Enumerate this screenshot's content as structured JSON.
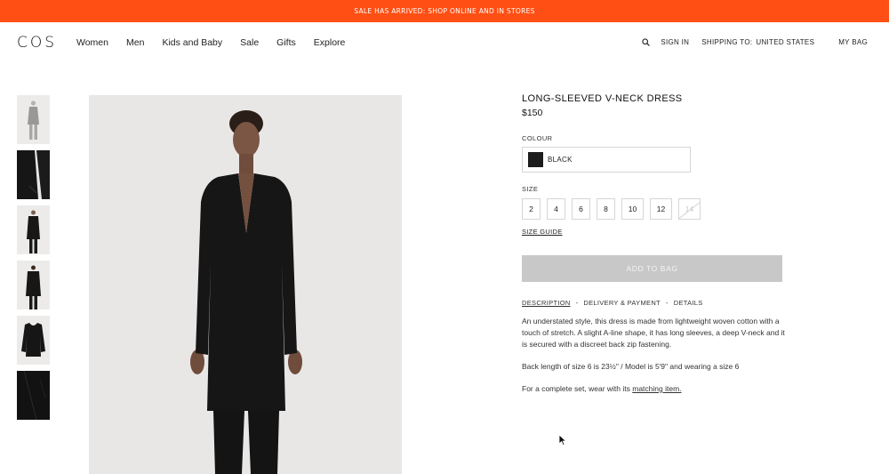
{
  "promo": {
    "text": "SALE HAS ARRIVED: SHOP ONLINE AND IN STORES"
  },
  "header": {
    "logo": "COS",
    "nav": [
      "Women",
      "Men",
      "Kids and Baby",
      "Sale",
      "Gifts",
      "Explore"
    ],
    "sign_in": "SIGN IN",
    "shipping_label": "SHIPPING TO:",
    "shipping_value": "UNITED STATES",
    "bag": "MY BAG",
    "search_icon": "search-icon"
  },
  "product": {
    "title": "LONG-SLEEVED V-NECK DRESS",
    "price": "$150",
    "colour_label": "COLOUR",
    "colour_value": "BLACK",
    "colour_hex": "#1c1c1c",
    "size_label": "SIZE",
    "sizes": [
      "2",
      "4",
      "6",
      "8",
      "10",
      "12",
      "14"
    ],
    "unavailable_sizes": [
      "14"
    ],
    "size_guide": "SIZE GUIDE",
    "add_to_bag": "ADD TO BAG",
    "tabs": [
      "DESCRIPTION",
      "DELIVERY & PAYMENT",
      "DETAILS"
    ],
    "tab_separator": "-",
    "description": "An understated style, this dress is made from lightweight woven cotton with a touch of stretch. A slight A-line shape, it has long sleeves, a deep V-neck and it is secured with a discreet back zip fastening.",
    "back_length": "Back length of size 6 is 23½\" / Model is 5'9\" and wearing a size 6",
    "complete_set_prefix": "For a complete set, wear with its ",
    "complete_set_link": "matching item."
  },
  "colors": {
    "promo_bg": "#ff4f14",
    "button_disabled": "#c8c8c8",
    "image_bg": "#e9e7e6"
  }
}
